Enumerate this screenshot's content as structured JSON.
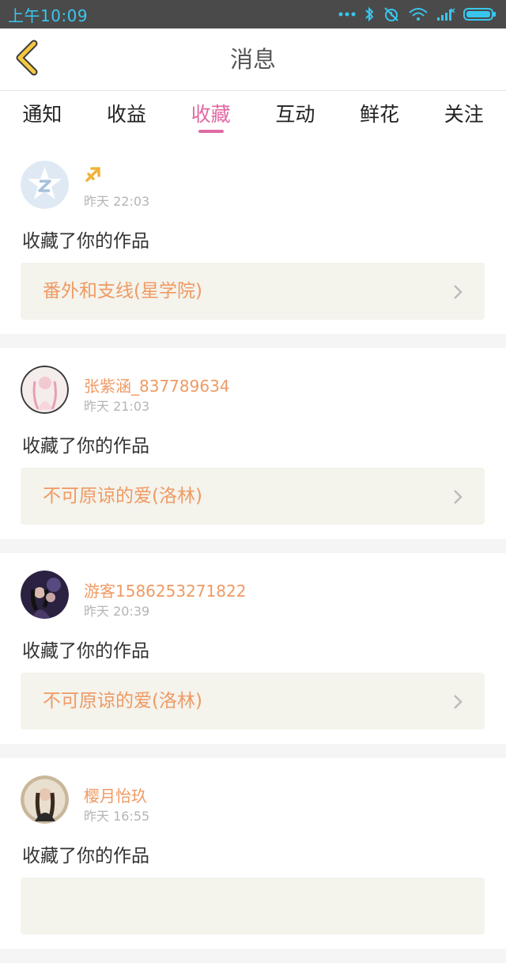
{
  "status_bar": {
    "time": "上午10:09",
    "icons": [
      "dots-icon",
      "bluetooth-icon",
      "alarm-off-icon",
      "wifi-icon",
      "signal-icon",
      "battery-icon"
    ]
  },
  "header": {
    "title": "消息",
    "back_icon": "chevron-left-icon"
  },
  "tabs": [
    {
      "label": "通知",
      "active": false
    },
    {
      "label": "收益",
      "active": false
    },
    {
      "label": "收藏",
      "active": true
    },
    {
      "label": "互动",
      "active": false
    },
    {
      "label": "鲜花",
      "active": false
    },
    {
      "label": "关注",
      "active": false
    }
  ],
  "messages": [
    {
      "name": "",
      "has_sign_icon": true,
      "time": "昨天 22:03",
      "action": "收藏了你的作品",
      "work": "番外和支线(星学院)"
    },
    {
      "name": "张紫涵_837789634",
      "time": "昨天 21:03",
      "action": "收藏了你的作品",
      "work": "不可原谅的爱(洛林)"
    },
    {
      "name": "游客1586253271822",
      "time": "昨天 20:39",
      "action": "收藏了你的作品",
      "work": "不可原谅的爱(洛林)"
    },
    {
      "name": "樱月怡玖",
      "time": "昨天 16:55",
      "action": "收藏了你的作品",
      "work": ""
    }
  ],
  "colors": {
    "status_bg": "#4a4a4a",
    "status_text": "#39c6ee",
    "accent_pink": "#e06aa3",
    "name_orange": "#ef9a63",
    "work_bg": "#f4f3ec",
    "back_yellow": "#f5c842"
  }
}
